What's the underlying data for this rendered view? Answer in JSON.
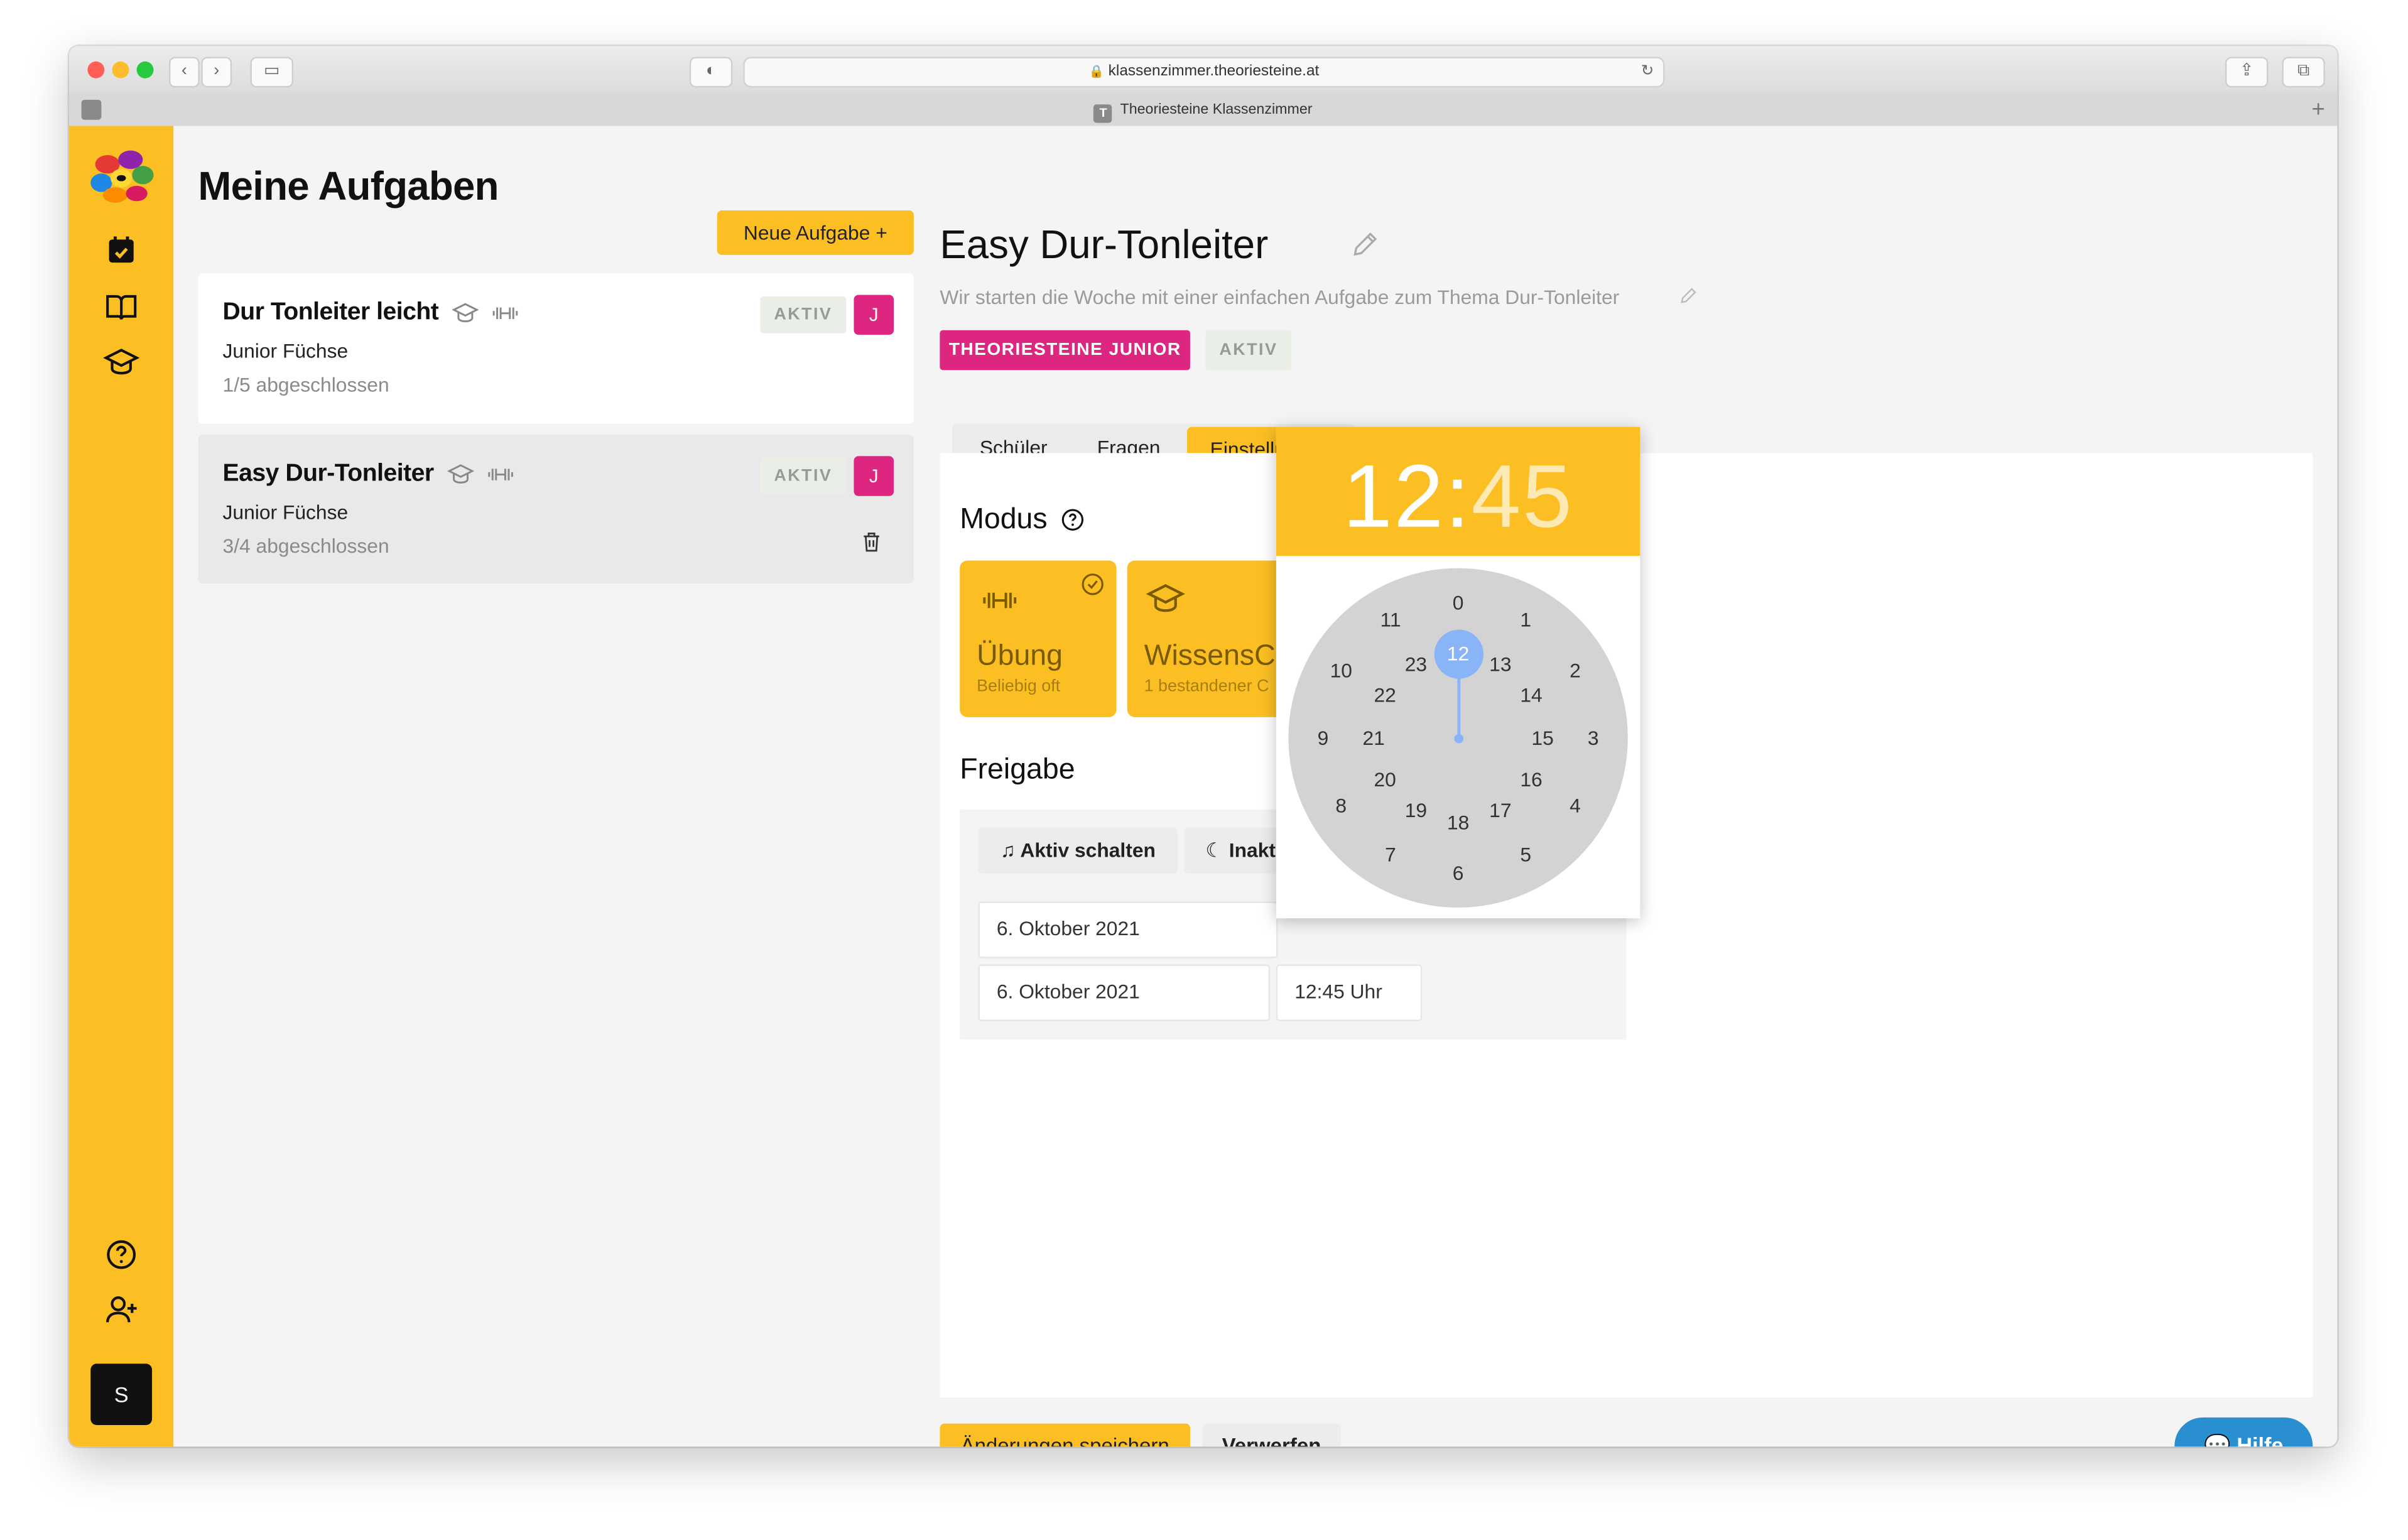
{
  "browser": {
    "url": "klassenzimmer.theoriesteine.at",
    "tab_title": "Theoriesteine Klassenzimmer",
    "tab_favicon_letter": "T"
  },
  "sidebar": {
    "user_initial": "S",
    "icons": [
      "logo",
      "calendar-icon",
      "book-icon",
      "graduation-cap-icon",
      "help-circle-icon",
      "user-plus-icon"
    ]
  },
  "tasks": {
    "title": "Meine Aufgaben",
    "new_button": "Neue Aufgabe +",
    "items": [
      {
        "title": "Dur Tonleiter leicht",
        "group": "Junior Füchse",
        "progress": "1/5 abgeschlossen",
        "status": "AKTIV",
        "avatar": "J"
      },
      {
        "title": "Easy Dur-Tonleiter",
        "group": "Junior Füchse",
        "progress": "3/4 abgeschlossen",
        "status": "AKTIV",
        "avatar": "J"
      }
    ]
  },
  "detail": {
    "title": "Easy Dur-Tonleiter",
    "description": "Wir starten die Woche mit einer einfachen Aufgabe zum Thema Dur-Tonleiter",
    "tag": "THEORIESTEINE JUNIOR",
    "status": "AKTIV",
    "tabs": [
      "Schüler",
      "Fragen",
      "Einstellungen"
    ],
    "active_tab": "Einstellungen",
    "modus_heading": "Modus",
    "modes": [
      {
        "title": "Übung",
        "subtitle": "Beliebig oft"
      },
      {
        "title": "WissensC",
        "subtitle": "1 bestandener C"
      }
    ],
    "freigabe_heading": "Freigabe",
    "aktiv_button": "Aktiv schalten",
    "inaktiv_button": "Inakt",
    "date1": "6. Oktober 2021",
    "date2": "6. Oktober 2021",
    "time2": "12:45 Uhr",
    "save_button": "Änderungen speichern",
    "discard_button": "Verwerfen",
    "help_button": "Hilfe"
  },
  "clock": {
    "hours": "12",
    "separator": ":",
    "minutes": "45",
    "selected_hour": "12",
    "outer_numbers": [
      "0",
      "1",
      "2",
      "3",
      "4",
      "5",
      "6",
      "7",
      "8",
      "9",
      "10",
      "11"
    ],
    "inner_numbers": [
      "12",
      "13",
      "14",
      "15",
      "16",
      "17",
      "18",
      "19",
      "20",
      "21",
      "22",
      "23"
    ]
  },
  "colors": {
    "accent": "#fbbf24",
    "pink": "#dc2680",
    "help_blue": "#2a8fd0",
    "clock_hand": "#8ab4f8"
  }
}
